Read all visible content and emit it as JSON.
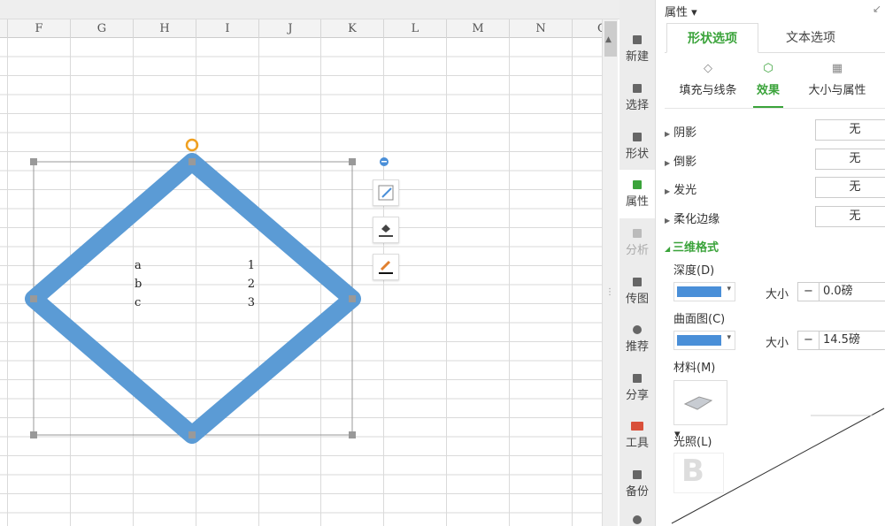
{
  "sheet": {
    "columns": [
      "F",
      "G",
      "H",
      "I",
      "J",
      "K",
      "L",
      "M",
      "N",
      "O"
    ],
    "cells": [
      {
        "label": "a",
        "value": "1"
      },
      {
        "label": "b",
        "value": "2"
      },
      {
        "label": "c",
        "value": "3"
      }
    ],
    "shape_color": "#5b9bd5"
  },
  "sidebar": {
    "items": [
      {
        "label": "新建"
      },
      {
        "label": "选择"
      },
      {
        "label": "形状"
      },
      {
        "label": "属性"
      },
      {
        "label": "分析"
      },
      {
        "label": "传图"
      },
      {
        "label": "推荐"
      },
      {
        "label": "分享"
      },
      {
        "label": "工具"
      },
      {
        "label": "备份"
      }
    ]
  },
  "panel": {
    "title": "属性 ▾",
    "tabs": [
      "形状选项",
      "文本选项"
    ],
    "subtabs": [
      "填充与线条",
      "效果",
      "大小与属性"
    ],
    "effects": [
      {
        "label": "阴影",
        "value": "无"
      },
      {
        "label": "倒影",
        "value": "无"
      },
      {
        "label": "发光",
        "value": "无"
      },
      {
        "label": "柔化边缘",
        "value": "无"
      }
    ],
    "section": "三维格式",
    "depth_label": "深度(D)",
    "contour_label": "曲面图(C)",
    "size_label": "大小",
    "depth_size": "0.0磅",
    "contour_size": "14.5磅",
    "minus": "−",
    "material_label": "材料(M)",
    "lighting_label": "光照(L)",
    "accent": "#3aa33a"
  }
}
